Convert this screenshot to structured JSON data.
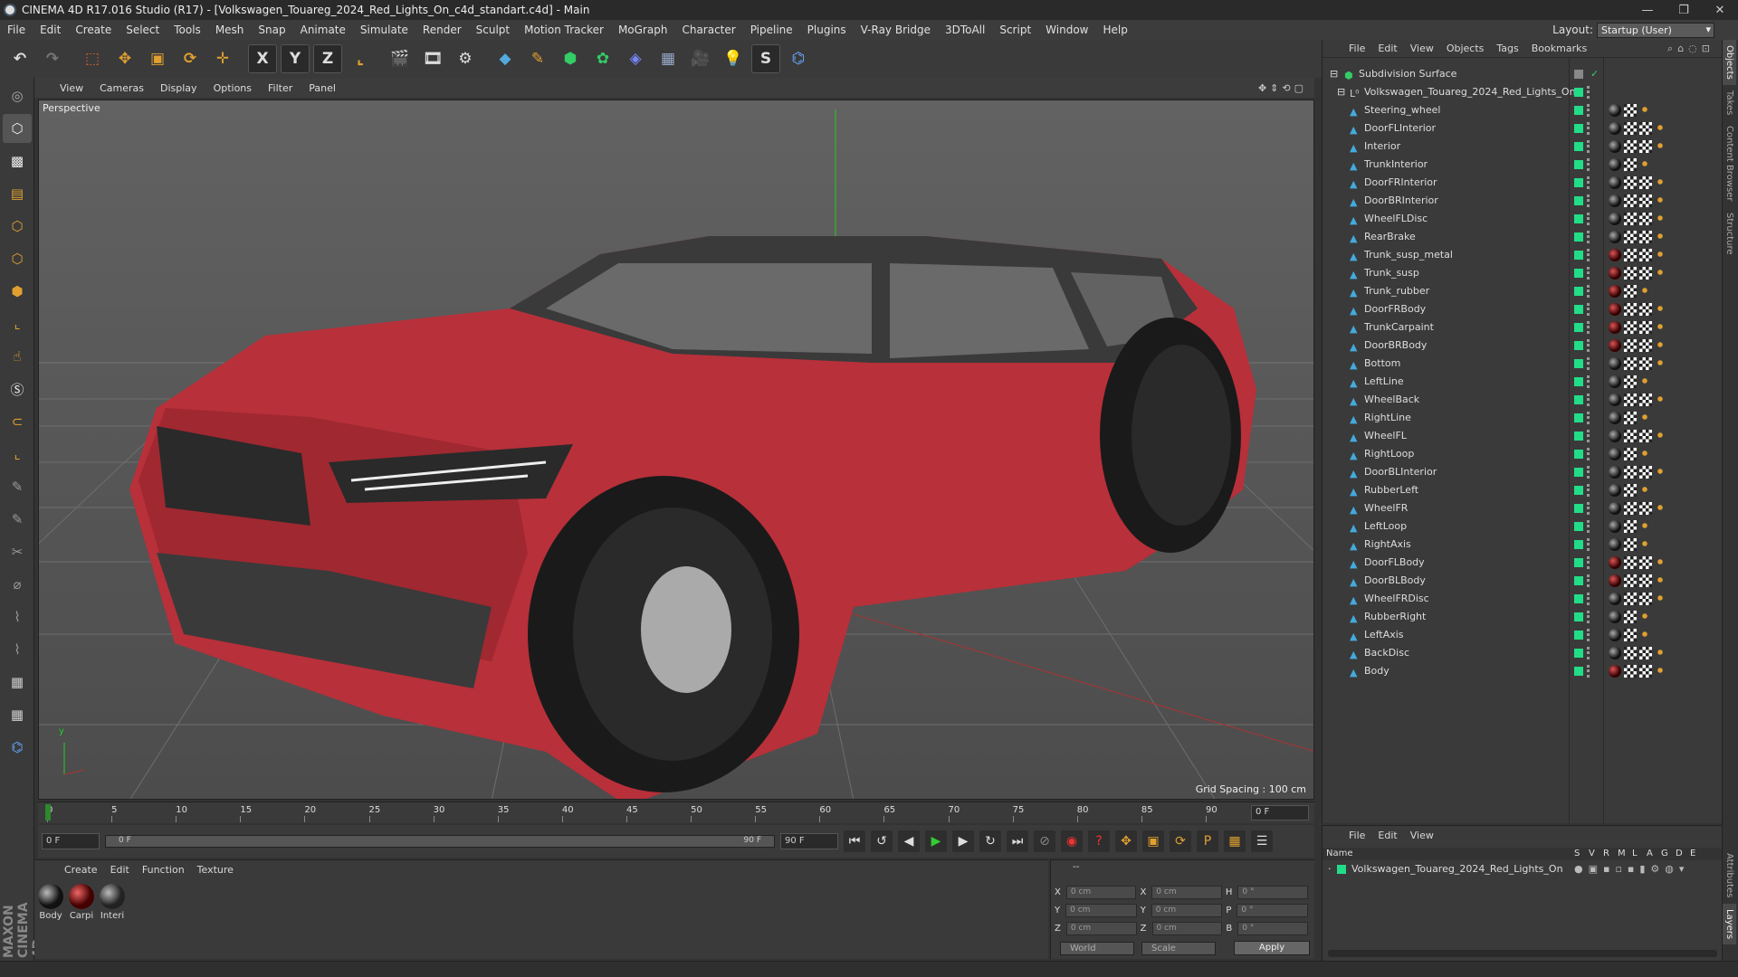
{
  "window": {
    "title": "CINEMA 4D R17.016 Studio (R17) - [Volkswagen_Touareg_2024_Red_Lights_On_c4d_standart.c4d] - Main",
    "controls": [
      "—",
      "❐",
      "✕"
    ]
  },
  "menubar": {
    "items": [
      "File",
      "Edit",
      "Create",
      "Select",
      "Tools",
      "Mesh",
      "Snap",
      "Animate",
      "Simulate",
      "Render",
      "Sculpt",
      "Motion Tracker",
      "MoGraph",
      "Character",
      "Pipeline",
      "Plugins",
      "V-Ray Bridge",
      "3DToAll",
      "Script",
      "Window",
      "Help"
    ],
    "layout_label": "Layout:",
    "layout_value": "Startup (User)"
  },
  "toolbar": {
    "axis_x": "X",
    "axis_y": "Y",
    "axis_z": "Z"
  },
  "viewport": {
    "menu": [
      "View",
      "Cameras",
      "Display",
      "Options",
      "Filter",
      "Panel"
    ],
    "label": "Perspective",
    "grid_spacing": "Grid Spacing : 100 cm",
    "nav_icons": "✥⇕⟲▢"
  },
  "timeline": {
    "ticks": [
      "0",
      "5",
      "10",
      "15",
      "20",
      "25",
      "30",
      "35",
      "40",
      "45",
      "50",
      "55",
      "60",
      "65",
      "70",
      "75",
      "80",
      "85",
      "90"
    ],
    "frame_field": "0 F"
  },
  "transport": {
    "start_field": "0 F",
    "slider_start": "0 F",
    "slider_end": "90 F",
    "end_field": "90 F",
    "max_field": "90 F"
  },
  "materials": {
    "menu": [
      "Create",
      "Edit",
      "Function",
      "Texture"
    ],
    "items": [
      {
        "name": "Body",
        "color": "#1a1a1a"
      },
      {
        "name": "Carpi",
        "color": "#8a1010"
      },
      {
        "name": "Interi",
        "color": "#2a2a2a"
      }
    ]
  },
  "attributes": {
    "header": "--",
    "rows": [
      {
        "a": "X",
        "av": "0 cm",
        "b": "X",
        "bv": "0 cm",
        "c": "H",
        "cv": "0 °"
      },
      {
        "a": "Y",
        "av": "0 cm",
        "b": "Y",
        "bv": "0 cm",
        "c": "P",
        "cv": "0 °"
      },
      {
        "a": "Z",
        "av": "0 cm",
        "b": "Z",
        "bv": "0 cm",
        "c": "B",
        "cv": "0 °"
      }
    ],
    "coord_mode": "World",
    "transform_mode": "Scale",
    "apply": "Apply"
  },
  "objects": {
    "menu": [
      "File",
      "Edit",
      "View",
      "Objects",
      "Tags",
      "Bookmarks"
    ],
    "root": "Subdivision Surface",
    "group": "Volkswagen_Touareg_2024_Red_Lights_On",
    "children": [
      {
        "name": "Steering_wheel",
        "mat": "dark",
        "chk": false
      },
      {
        "name": "DoorFLInterior",
        "mat": "dark",
        "chk": true
      },
      {
        "name": "Interior",
        "mat": "dark",
        "chk": true
      },
      {
        "name": "TrunkInterior",
        "mat": "dark",
        "chk": false
      },
      {
        "name": "DoorFRInterior",
        "mat": "dark",
        "chk": true
      },
      {
        "name": "DoorBRInterior",
        "mat": "dark",
        "chk": true
      },
      {
        "name": "WheelFLDisc",
        "mat": "dark",
        "chk": true
      },
      {
        "name": "RearBrake",
        "mat": "dark",
        "chk": true
      },
      {
        "name": "Trunk_susp_metal",
        "mat": "red",
        "chk": true
      },
      {
        "name": "Trunk_susp",
        "mat": "red",
        "chk": true
      },
      {
        "name": "Trunk_rubber",
        "mat": "red",
        "chk": false
      },
      {
        "name": "DoorFRBody",
        "mat": "red",
        "chk": true
      },
      {
        "name": "TrunkCarpaint",
        "mat": "red",
        "chk": true
      },
      {
        "name": "DoorBRBody",
        "mat": "red",
        "chk": true
      },
      {
        "name": "Bottom",
        "mat": "dark",
        "chk": true
      },
      {
        "name": "LeftLine",
        "mat": "dark",
        "chk": false
      },
      {
        "name": "WheelBack",
        "mat": "dark",
        "chk": true
      },
      {
        "name": "RightLine",
        "mat": "dark",
        "chk": false
      },
      {
        "name": "WheelFL",
        "mat": "dark",
        "chk": true
      },
      {
        "name": "RightLoop",
        "mat": "dark",
        "chk": false
      },
      {
        "name": "DoorBLInterior",
        "mat": "dark",
        "chk": true
      },
      {
        "name": "RubberLeft",
        "mat": "dark",
        "chk": false
      },
      {
        "name": "WheelFR",
        "mat": "dark",
        "chk": true
      },
      {
        "name": "LeftLoop",
        "mat": "dark",
        "chk": false
      },
      {
        "name": "RightAxis",
        "mat": "dark",
        "chk": false
      },
      {
        "name": "DoorFLBody",
        "mat": "red",
        "chk": true
      },
      {
        "name": "DoorBLBody",
        "mat": "red",
        "chk": true
      },
      {
        "name": "WheelFRDisc",
        "mat": "dark",
        "chk": true
      },
      {
        "name": "RubberRight",
        "mat": "dark",
        "chk": false
      },
      {
        "name": "LeftAxis",
        "mat": "dark",
        "chk": false
      },
      {
        "name": "BackDisc",
        "mat": "dark",
        "chk": true
      },
      {
        "name": "Body",
        "mat": "red",
        "chk": true
      }
    ]
  },
  "layers": {
    "menu": [
      "File",
      "Edit",
      "View"
    ],
    "columns": [
      "Name",
      "S",
      "V",
      "R",
      "M",
      "L",
      "A",
      "G",
      "D",
      "E"
    ],
    "row": "Volkswagen_Touareg_2024_Red_Lights_On"
  },
  "sidetabs": [
    "Objects",
    "Takes",
    "Content Browser",
    "Structure",
    "Attributes",
    "Layers"
  ],
  "brand": "MAXON CINEMA 4D",
  "colors": {
    "accent": "#e0a030",
    "car_body": "#b8303a",
    "tag_green": "#22dd88"
  }
}
